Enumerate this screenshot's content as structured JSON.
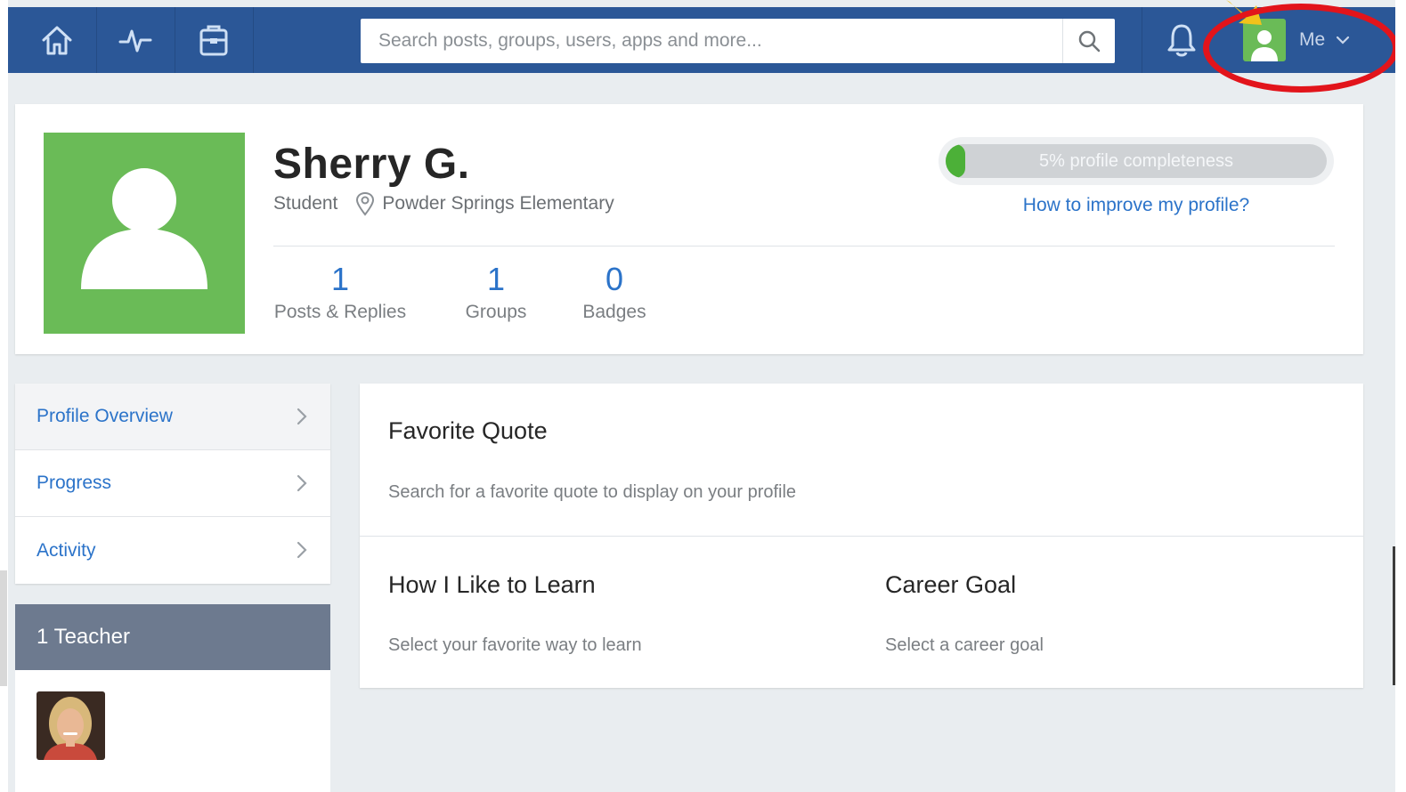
{
  "topbar": {
    "nav": [
      {
        "name": "home",
        "icon": "home-icon"
      },
      {
        "name": "activity",
        "icon": "pulse-icon"
      },
      {
        "name": "backpack",
        "icon": "backpack-icon"
      }
    ],
    "search_placeholder": "Search posts, groups, users, apps and more...",
    "me_label": "Me"
  },
  "profile": {
    "name": "Sherry G.",
    "role": "Student",
    "school": "Powder Springs Elementary",
    "completeness_text": "5% profile completeness",
    "completeness_fraction": 0.05,
    "improve_link": "How to improve my profile?",
    "stats": [
      {
        "value": "1",
        "label": "Posts & Replies"
      },
      {
        "value": "1",
        "label": "Groups"
      },
      {
        "value": "0",
        "label": "Badges"
      }
    ]
  },
  "sidenav": {
    "items": [
      {
        "label": "Profile Overview",
        "active": true
      },
      {
        "label": "Progress",
        "active": false
      },
      {
        "label": "Activity",
        "active": false
      }
    ]
  },
  "teachers": {
    "header": "1 Teacher"
  },
  "main": {
    "favorite_quote": {
      "title": "Favorite Quote",
      "text": "Search for a favorite quote to display on your profile"
    },
    "learn": {
      "title": "How I Like to Learn",
      "text": "Select your favorite way to learn"
    },
    "career": {
      "title": "Career Goal",
      "text": "Select a career goal"
    }
  },
  "colors": {
    "topbar": "#2b5797",
    "accent": "#2b73c9",
    "avatar_green": "#6abb57",
    "highlight": "#e2141b"
  }
}
